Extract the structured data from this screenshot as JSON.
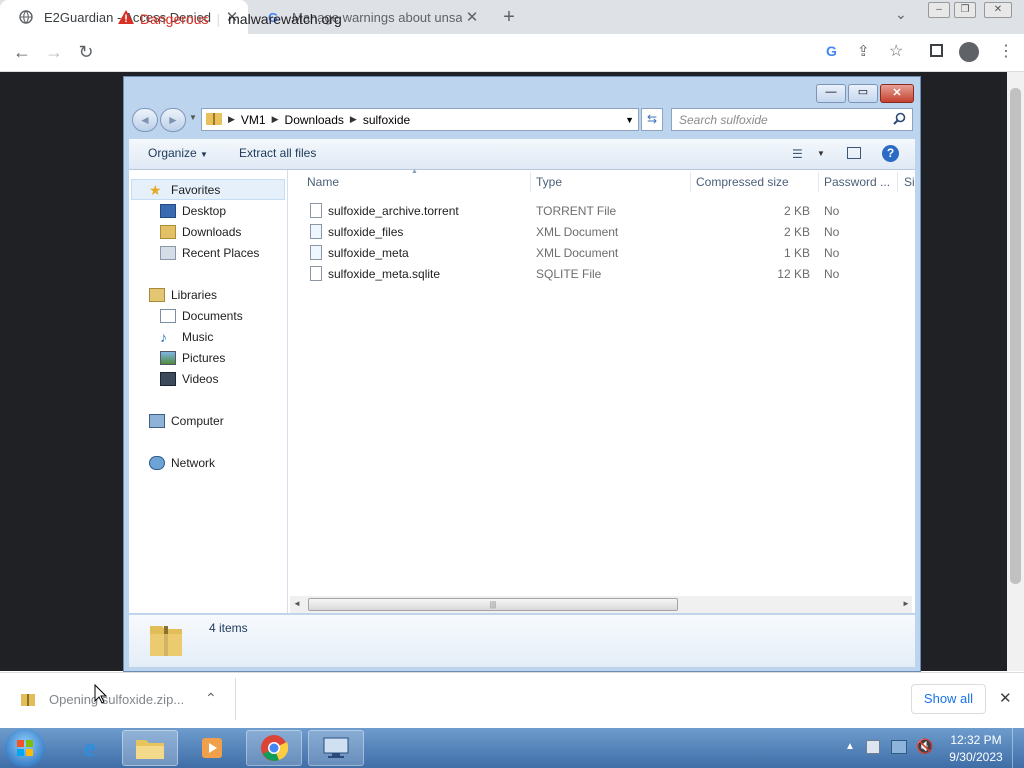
{
  "browser": {
    "tabs": [
      {
        "title": "E2Guardian - Access Denied"
      },
      {
        "title": "Manage warnings about unsafe sites"
      }
    ],
    "security_label": "Dangerous",
    "url": "malwarewatch.org"
  },
  "explorer": {
    "breadcrumb": [
      "VM1",
      "Downloads",
      "sulfoxide"
    ],
    "search_placeholder": "Search sulfoxide",
    "commands": {
      "organize": "Organize",
      "extract_all": "Extract all files"
    },
    "nav": {
      "favorites": "Favorites",
      "favorites_items": [
        "Desktop",
        "Downloads",
        "Recent Places"
      ],
      "libraries": "Libraries",
      "libraries_items": [
        "Documents",
        "Music",
        "Pictures",
        "Videos"
      ],
      "computer": "Computer",
      "network": "Network"
    },
    "columns": [
      "Name",
      "Type",
      "Compressed size",
      "Password ...",
      "Si"
    ],
    "files": [
      {
        "name": "sulfoxide_archive.torrent",
        "type": "TORRENT File",
        "size": "2 KB",
        "password": "No"
      },
      {
        "name": "sulfoxide_files",
        "type": "XML Document",
        "size": "2 KB",
        "password": "No"
      },
      {
        "name": "sulfoxide_meta",
        "type": "XML Document",
        "size": "1 KB",
        "password": "No"
      },
      {
        "name": "sulfoxide_meta.sqlite",
        "type": "SQLITE File",
        "size": "12 KB",
        "password": "No"
      }
    ],
    "item_count": "4 items"
  },
  "downloads": {
    "item_label": "Opening sulfoxide.zip...",
    "show_all": "Show all"
  },
  "taskbar": {
    "time": "12:32 PM",
    "date": "9/30/2023"
  },
  "colors": {
    "danger": "#d93025",
    "taskbar": "#4a7ab5",
    "page_background": "#202124"
  }
}
